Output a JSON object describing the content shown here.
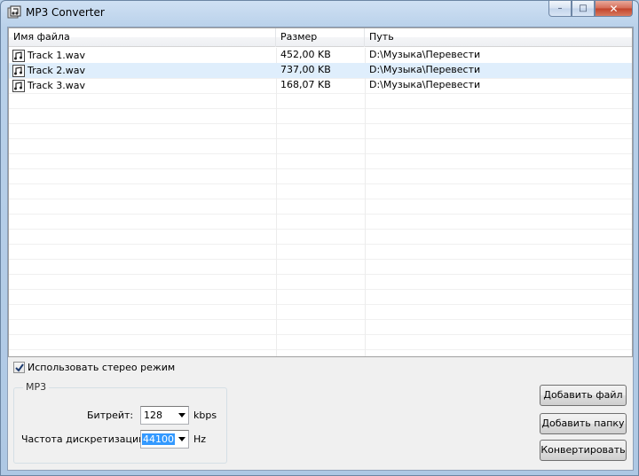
{
  "window": {
    "title": "MP3 Converter",
    "controls": {
      "minimize": "–",
      "maximize": "□",
      "close": "✕"
    }
  },
  "list": {
    "headers": {
      "name": "Имя файла",
      "size": "Размер",
      "path": "Путь"
    },
    "rows": [
      {
        "name": "Track 1.wav",
        "size": "452,00 KB",
        "path": "D:\\Музыка\\Перевести",
        "selected": false
      },
      {
        "name": "Track 2.wav",
        "size": "737,00 KB",
        "path": "D:\\Музыка\\Перевести",
        "selected": true
      },
      {
        "name": "Track 3.wav",
        "size": "168,07 KB",
        "path": "D:\\Музыка\\Перевести",
        "selected": false
      }
    ]
  },
  "options": {
    "stereo_label": "Использовать стерео режим",
    "stereo_checked": true
  },
  "mp3_group": {
    "title": "MP3",
    "bitrate_label": "Битрейт:",
    "bitrate_value": "128",
    "bitrate_unit": "kbps",
    "samplerate_label": "Частота дискретизации",
    "samplerate_value": "44100",
    "samplerate_unit": "Hz"
  },
  "buttons": {
    "add_file": "Добавить файл",
    "add_folder": "Добавить папку",
    "convert": "Конвертировать"
  },
  "icons": {
    "app": "app-icon",
    "file": "audio-file-icon",
    "check": "checkmark-icon"
  },
  "colors": {
    "selection": "#dfeefc",
    "highlight": "#3399ff",
    "titlebar": "#b9d1ea"
  }
}
